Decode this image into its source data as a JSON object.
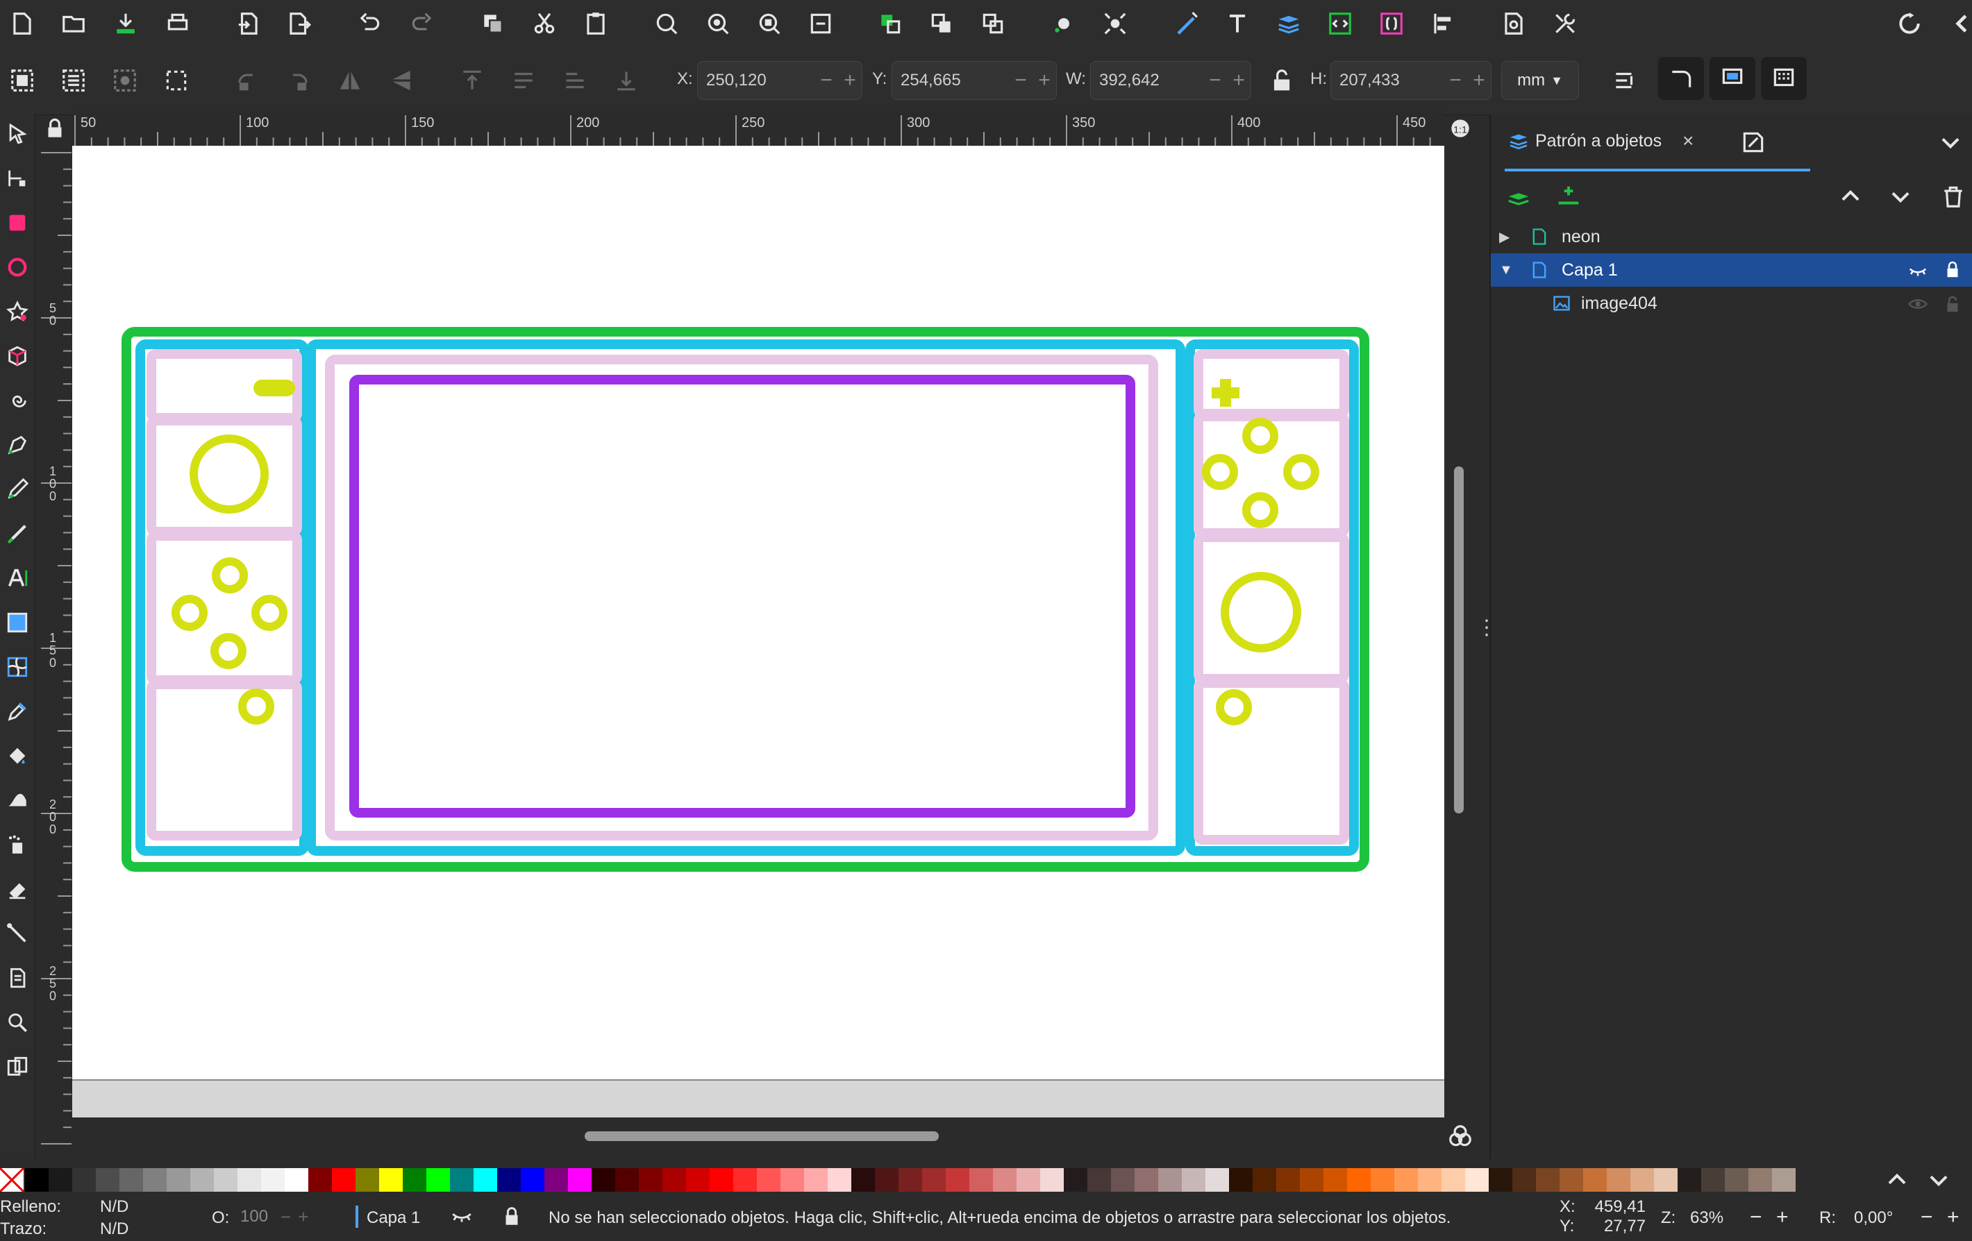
{
  "colors": {
    "panel_bg": "#2b2b2b",
    "selection": "#1f4e99",
    "accent": "#4aa3ff",
    "green_frame": "#1dc33f",
    "cyan_frame": "#1fc3e6",
    "pink": "#e8c6e6",
    "purple": "#9b30e6",
    "yellow": "#d4e012"
  },
  "toolbar_icons": [
    "new-document-icon",
    "open-icon",
    "save-icon",
    "print-icon",
    "import-icon",
    "export-icon",
    "undo-icon",
    "redo-icon",
    "duplicate-icon",
    "cut-icon",
    "paste-icon",
    "zoom-selection-icon",
    "zoom-drawing-icon",
    "zoom-page-icon",
    "zoom-page-width-icon",
    "group-icon",
    "ungroup-icon",
    "clone-icon",
    "node-icon",
    "snap-icon",
    "fill-stroke-icon",
    "text-icon",
    "layers-icon",
    "xml-editor-icon",
    "selectors-icon",
    "align-icon",
    "document-properties-icon",
    "preferences-icon"
  ],
  "coords": {
    "x_label": "X:",
    "x_value": "250,120",
    "y_label": "Y:",
    "y_value": "254,665",
    "w_label": "W:",
    "w_value": "392,642",
    "h_label": "H:",
    "h_value": "207,433",
    "unit": "mm"
  },
  "ruler": {
    "h_ticks": [
      "50",
      "100",
      "150",
      "200",
      "250",
      "300",
      "350",
      "400",
      "450"
    ],
    "v_ticks": [
      "5\n0",
      "1\n0\n0",
      "1\n5\n0",
      "2\n0\n0",
      "2\n5\n0"
    ]
  },
  "tools": [
    "selector-tool",
    "node-tool",
    "rectangle-tool",
    "ellipse-tool",
    "star-tool",
    "3d-box-tool",
    "spiral-tool",
    "pen-tool",
    "pencil-tool",
    "calligraphy-tool",
    "text-tool",
    "gradient-tool",
    "mesh-tool",
    "dropper-tool",
    "paint-bucket-tool",
    "tweak-tool",
    "spray-tool",
    "eraser-tool",
    "connector-tool",
    "pages-tool",
    "zoom-tool",
    "measure-tool"
  ],
  "panel": {
    "tab_label": "Patrón a objetos",
    "layers": [
      {
        "label": "neon",
        "expanded": false
      },
      {
        "label": "Capa 1",
        "expanded": true,
        "selected": true
      },
      {
        "label": "image404",
        "child": true
      }
    ]
  },
  "palette": [
    "#000000",
    "#1a1a1a",
    "#333333",
    "#4d4d4d",
    "#666666",
    "#808080",
    "#999999",
    "#b3b3b3",
    "#cccccc",
    "#e6e6e6",
    "#f2f2f2",
    "#ffffff",
    "#800000",
    "#ff0000",
    "#808000",
    "#ffff00",
    "#008000",
    "#00ff00",
    "#008080",
    "#00ffff",
    "#000080",
    "#0000ff",
    "#800080",
    "#ff00ff",
    "#2b0000",
    "#550000",
    "#800000",
    "#aa0000",
    "#d40000",
    "#ff0000",
    "#ff2a2a",
    "#ff5555",
    "#ff8080",
    "#ffaaaa",
    "#ffd5d5",
    "#280b0b",
    "#501616",
    "#782121",
    "#a02c2c",
    "#c83737",
    "#d35f5f",
    "#de8787",
    "#e9afaf",
    "#f4d7d7",
    "#241c1c",
    "#483737",
    "#6c5353",
    "#916f6f",
    "#ac9393",
    "#c8b7b7",
    "#e3dbdb",
    "#2b1100",
    "#552200",
    "#803300",
    "#aa4400",
    "#d45500",
    "#ff6600",
    "#ff7f2a",
    "#ff9955",
    "#ffb380",
    "#ffccaa",
    "#ffe6d5",
    "#28170b",
    "#502d16",
    "#784421",
    "#a05a2c",
    "#c87137",
    "#d38d5f",
    "#deaa87",
    "#e9c6af",
    "#241f1c",
    "#483e37",
    "#6c5d53",
    "#917c6f",
    "#ac9d93"
  ],
  "status": {
    "fill_label": "Relleno:",
    "fill_value": "N/D",
    "stroke_label": "Trazo:",
    "stroke_value": "N/D",
    "opacity_label": "O:",
    "opacity_value": "100",
    "layer": "Capa 1",
    "message": "No se han seleccionado objetos. Haga clic, Shift+clic, Alt+rueda encima de objetos o arrastre para seleccionar los objetos.",
    "cx_label": "X:",
    "cx_value": "459,41",
    "cy_label": "Y:",
    "cy_value": "27,77",
    "zoom_label": "Z:",
    "zoom_value": "63%",
    "rot_label": "R:",
    "rot_value": "0,00°"
  }
}
